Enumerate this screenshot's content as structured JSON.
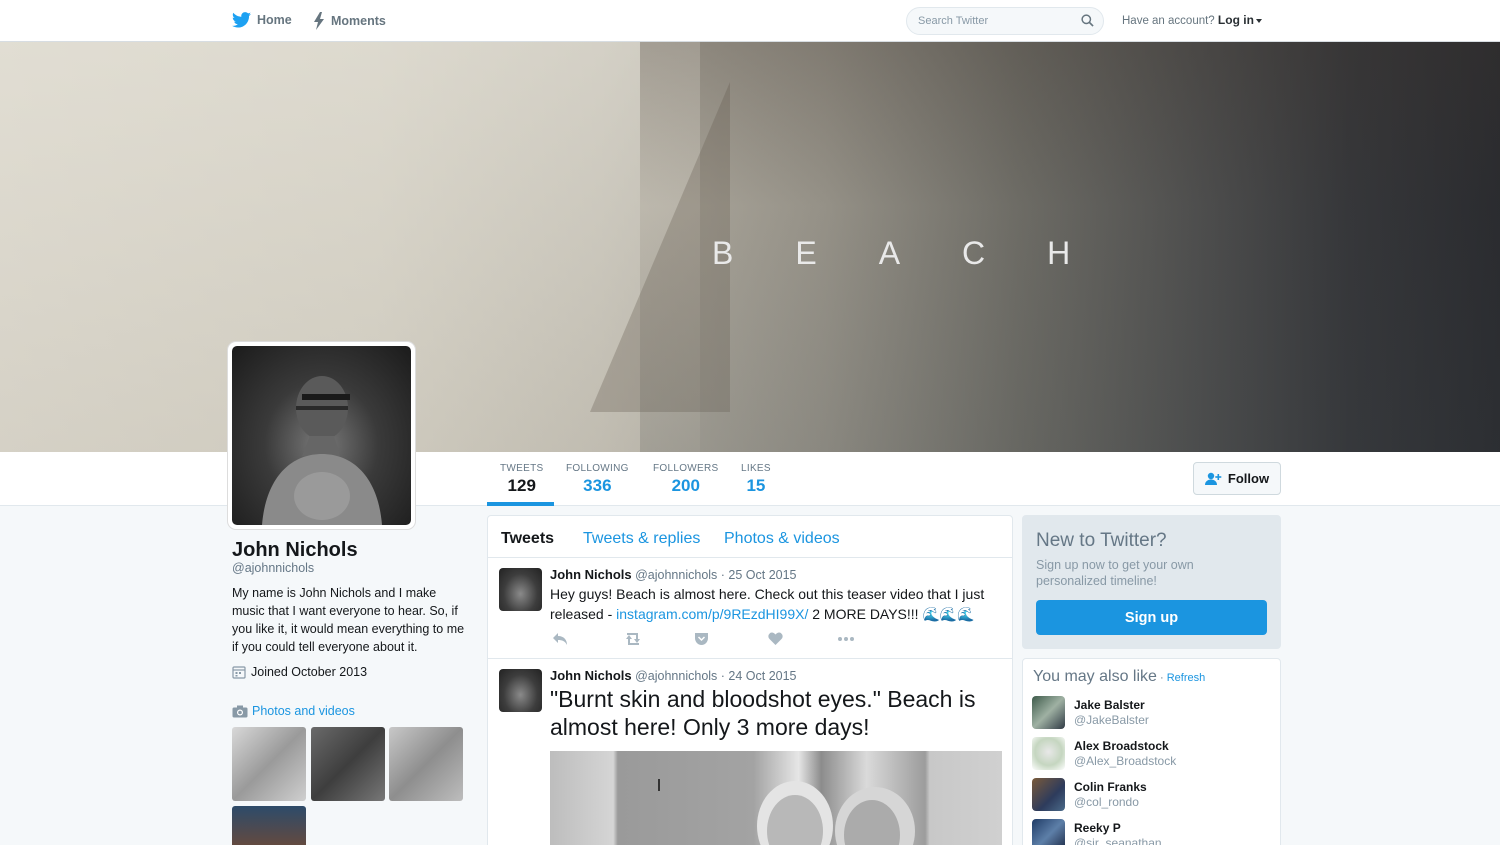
{
  "topnav": {
    "home_label": "Home",
    "moments_label": "Moments",
    "search_placeholder": "Search Twitter",
    "account_prompt": "Have an account?",
    "login_label": "Log in"
  },
  "banner": {
    "title": "BEACH"
  },
  "profile_nav": {
    "stats": [
      {
        "label": "TWEETS",
        "value": "129"
      },
      {
        "label": "FOLLOWING",
        "value": "336"
      },
      {
        "label": "FOLLOWERS",
        "value": "200"
      },
      {
        "label": "LIKES",
        "value": "15"
      }
    ],
    "follow_label": "Follow"
  },
  "profile": {
    "name": "John Nichols",
    "handle": "@ajohnnichols",
    "bio": "My name is John Nichols and I make music that I want everyone to hear. So, if you like it, it would mean everything to me if you could tell everyone about it.",
    "joined": "Joined October 2013",
    "photos_label": "Photos and videos"
  },
  "timeline": {
    "tabs": [
      "Tweets",
      "Tweets & replies",
      "Photos & videos"
    ],
    "tweets": [
      {
        "name": "John Nichols",
        "meta": "@ajohnnichols · 25 Oct 2015",
        "text_before": "Hey guys! Beach is almost here. Check out this teaser video that I just released - ",
        "link": "instagram.com/p/9REzdHI99X/",
        "text_after": " 2 MORE DAYS!!! 🌊🌊🌊"
      },
      {
        "name": "John Nichols",
        "meta": "@ajohnnichols · 24 Oct 2015",
        "text": "\"Burnt skin and bloodshot eyes.\" Beach is almost here! Only 3 more days!"
      }
    ]
  },
  "sidebar": {
    "signup": {
      "title": "New to Twitter?",
      "desc": "Sign up now to get your own personalized timeline!",
      "button": "Sign up"
    },
    "wtf": {
      "title": "You may also like",
      "sep": " · ",
      "refresh": "Refresh",
      "users": [
        {
          "name": "Jake Balster",
          "handle": "@JakeBalster"
        },
        {
          "name": "Alex Broadstock",
          "handle": "@Alex_Broadstock"
        },
        {
          "name": "Colin Franks",
          "handle": "@col_rondo"
        },
        {
          "name": "Reeky P",
          "handle": "@sir_seanathan"
        }
      ]
    }
  },
  "colors": {
    "accent": "#1b95e0",
    "text": "#14171a",
    "muted": "#657786"
  }
}
